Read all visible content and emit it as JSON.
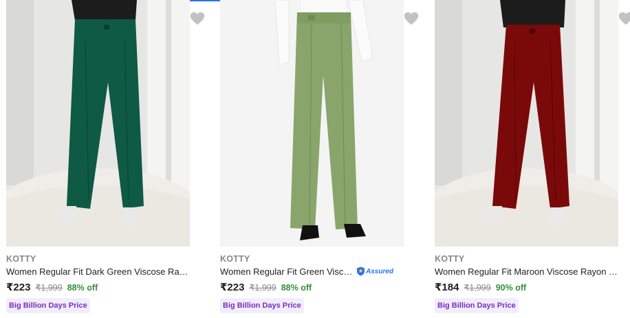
{
  "colors": {
    "brand_text": "#878787",
    "price_text": "#212121",
    "discount_green": "#388e3c",
    "assured_blue": "#2874f0",
    "badge_bg": "#f1eefc",
    "badge_text": "#7b2cbf",
    "wishlist_grey": "#c2c2c2"
  },
  "products": [
    {
      "brand": "KOTTY",
      "title": "Women Regular Fit Dark Green Viscose Rayon Trousers",
      "price": "₹223",
      "mrp": "₹1,999",
      "discount": "88% off",
      "badge": "Big Billion Days Price",
      "icon": "heart-icon"
    },
    {
      "brand": "KOTTY",
      "title": "Women Regular Fit Green Viscose Rayon Trousers",
      "assured_label": "Assured",
      "price": "₹223",
      "mrp": "₹1,999",
      "discount": "88% off",
      "badge": "Big Billion Days Price",
      "icon": "heart-icon"
    },
    {
      "brand": "KOTTY",
      "title": "Women Regular Fit Maroon Viscose Rayon Trousers",
      "price": "₹184",
      "mrp": "₹1,999",
      "discount": "90% off",
      "badge": "Big Billion Days Price",
      "icon": "heart-icon"
    }
  ]
}
